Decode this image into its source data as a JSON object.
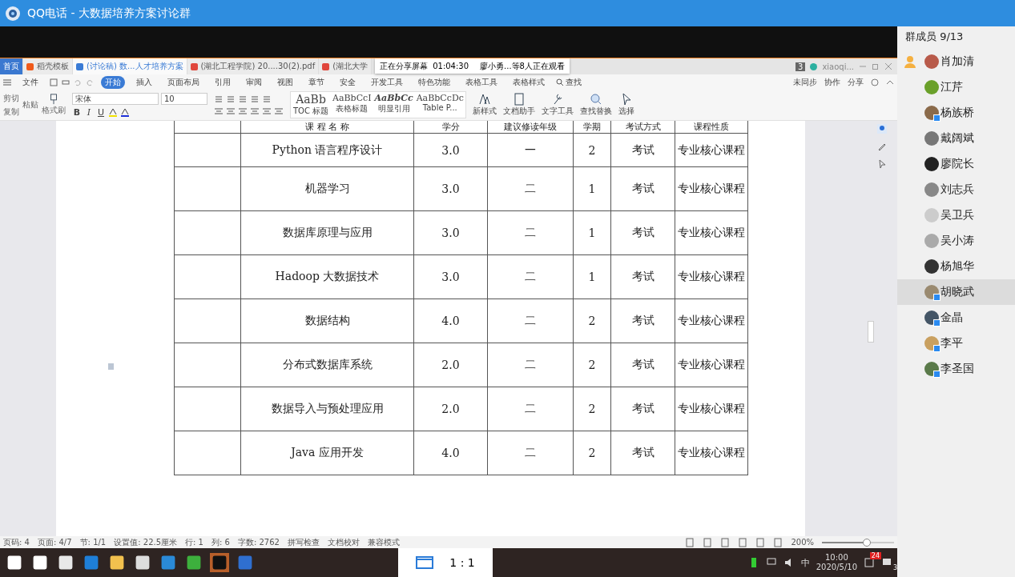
{
  "window": {
    "title": "QQ电话 - 大数据培养方案讨论群"
  },
  "share_notice": {
    "status": "正在分享屏幕",
    "time": "01:04:30",
    "viewers": "廖小勇...等8人正在观看"
  },
  "wps_tabs": [
    {
      "label": "首页",
      "kind": "home",
      "selected": false
    },
    {
      "label": "稻壳模板",
      "kind": "template",
      "selected": false
    },
    {
      "label": "(讨论稿) 数...人才培养方案",
      "kind": "doc",
      "selected": true
    },
    {
      "label": "(湖北工程学院) 20....30(2).pdf",
      "kind": "pdf",
      "selected": false
    },
    {
      "label": "(湖北大学",
      "kind": "pdf",
      "selected": false
    }
  ],
  "account": "xiaoqi...",
  "page_count": "3",
  "menu": [
    {
      "label": "文件",
      "selected": false
    },
    {
      "label": "开始",
      "selected": true
    },
    {
      "label": "插入",
      "selected": false
    },
    {
      "label": "页面布局",
      "selected": false
    },
    {
      "label": "引用",
      "selected": false
    },
    {
      "label": "审阅",
      "selected": false
    },
    {
      "label": "视图",
      "selected": false
    },
    {
      "label": "章节",
      "selected": false
    },
    {
      "label": "安全",
      "selected": false
    },
    {
      "label": "开发工具",
      "selected": false
    },
    {
      "label": "特色功能",
      "selected": false
    },
    {
      "label": "表格工具",
      "selected": false
    },
    {
      "label": "表格样式",
      "selected": false
    }
  ],
  "search_label": "查找",
  "menu_right": [
    "未同步",
    "协作",
    "分享"
  ],
  "ribbon": {
    "cut": "剪切",
    "copy": "复制",
    "paste": "粘贴",
    "format_painter": "格式刷",
    "font": "宋体",
    "size": "10",
    "format_buttons": [
      "B",
      "I",
      "U"
    ],
    "styles": [
      {
        "sample": "AaBb",
        "label": "TOC 标题"
      },
      {
        "sample": "AaBbCcI",
        "label": "表格标题"
      },
      {
        "sample": "AaBbCc",
        "label": "明显引用"
      },
      {
        "sample": "AaBbCcDc",
        "label": "Table P..."
      }
    ],
    "tools": [
      "新样式",
      "文档助手",
      "文字工具",
      "查找替换",
      "选择"
    ]
  },
  "table": {
    "columns": [
      "课 程 名 称",
      "学分",
      "建议修读年级",
      "学期",
      "考试方式",
      "课程性质"
    ],
    "rows": [
      [
        "Python 语言程序设计",
        "3.0",
        "一",
        "2",
        "考试",
        "专业核心课程"
      ],
      [
        "机器学习",
        "3.0",
        "二",
        "1",
        "考试",
        "专业核心课程"
      ],
      [
        "数据库原理与应用",
        "3.0",
        "二",
        "1",
        "考试",
        "专业核心课程"
      ],
      [
        "Hadoop 大数据技术",
        "3.0",
        "二",
        "1",
        "考试",
        "专业核心课程"
      ],
      [
        "数据结构",
        "4.0",
        "二",
        "2",
        "考试",
        "专业核心课程"
      ],
      [
        "分布式数据库系统",
        "2.0",
        "二",
        "2",
        "考试",
        "专业核心课程"
      ],
      [
        "数据导入与预处理应用",
        "2.0",
        "二",
        "2",
        "考试",
        "专业核心课程"
      ],
      [
        "Java 应用开发",
        "4.0",
        "二",
        "2",
        "考试",
        "专业核心课程"
      ]
    ]
  },
  "status_bar": [
    "页码: 4",
    "页面: 4/7",
    "节: 1/1",
    "设置值: 22.5厘米",
    "行: 1",
    "列: 6",
    "字数: 2762",
    "拼写检查",
    "文档校对",
    "兼容模式"
  ],
  "zoom": {
    "reading": "200%",
    "level": 0.62
  },
  "taskbar": {
    "ime": "中",
    "time": "10:00",
    "date": "2020/5/10",
    "calendar_badge": "24",
    "notifications": "3"
  },
  "ratio": "1 : 1",
  "members_header": "群成员 9/13",
  "members": [
    {
      "name": "肖加清",
      "owner": true,
      "badge": false,
      "selected": false
    },
    {
      "name": "江芹",
      "owner": false,
      "badge": false,
      "selected": false
    },
    {
      "name": "杨族桥",
      "owner": false,
      "badge": true,
      "selected": false
    },
    {
      "name": "戴阔斌",
      "owner": false,
      "badge": false,
      "selected": false
    },
    {
      "name": "廖院长",
      "owner": false,
      "badge": false,
      "selected": false
    },
    {
      "name": "刘志兵",
      "owner": false,
      "badge": false,
      "selected": false
    },
    {
      "name": "吴卫兵",
      "owner": false,
      "badge": false,
      "selected": false
    },
    {
      "name": "吴小涛",
      "owner": false,
      "badge": false,
      "selected": false
    },
    {
      "name": "杨旭华",
      "owner": false,
      "badge": false,
      "selected": false
    },
    {
      "name": "胡晓武",
      "owner": false,
      "badge": true,
      "selected": true
    },
    {
      "name": "金晶",
      "owner": false,
      "badge": true,
      "selected": false
    },
    {
      "name": "李平",
      "owner": false,
      "badge": true,
      "selected": false
    },
    {
      "name": "李圣国",
      "owner": false,
      "badge": true,
      "selected": false
    }
  ]
}
